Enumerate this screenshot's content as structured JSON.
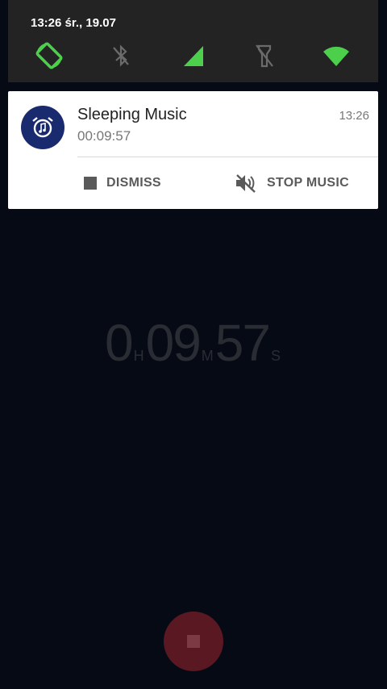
{
  "status_shade": {
    "time_date": "13:26  śr., 19.07",
    "tiles": [
      {
        "icon": "auto-rotate-icon",
        "state": "on",
        "color": "#4cd04c"
      },
      {
        "icon": "bluetooth-off-icon",
        "state": "off",
        "color": "#6b6b6b"
      },
      {
        "icon": "cellular-signal-icon",
        "state": "on",
        "color": "#4cd04c"
      },
      {
        "icon": "flashlight-off-icon",
        "state": "off",
        "color": "#6b6b6b"
      },
      {
        "icon": "wifi-icon",
        "state": "on",
        "color": "#4cd04c"
      }
    ]
  },
  "notification": {
    "app_icon": "alarm-clock-music-icon",
    "title": "Sleeping Music",
    "subtitle": "00:09:57",
    "time": "13:26",
    "actions": [
      {
        "icon": "stop-square-icon",
        "label": "DISMISS"
      },
      {
        "icon": "volume-mute-icon",
        "label": "STOP MUSIC"
      }
    ]
  },
  "timer": {
    "hours": "0",
    "hours_unit": "H",
    "minutes": "09",
    "minutes_unit": "M",
    "seconds": "57",
    "seconds_unit": "S"
  },
  "stop_button": {
    "icon": "stop-square-icon",
    "color": "#5a1822"
  }
}
